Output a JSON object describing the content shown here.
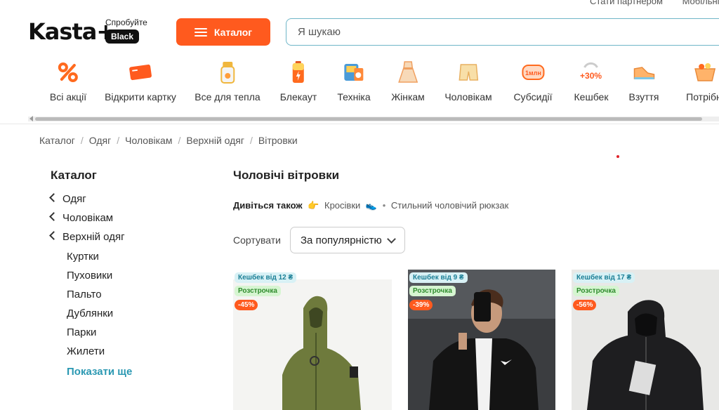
{
  "header": {
    "top_links": [
      "Стати партнером",
      "Мобільні"
    ],
    "logo_text": "Kasta+",
    "promo_try": "Спробуйте",
    "promo_black": "Black",
    "catalog_button": "Каталог",
    "search_placeholder": "Я шукаю"
  },
  "categories": [
    {
      "label": "Всі акції",
      "icon": "percent-icon"
    },
    {
      "label": "Відкрити картку",
      "icon": "card-icon"
    },
    {
      "label": "Все для тепла",
      "icon": "heater-icon"
    },
    {
      "label": "Блекаут",
      "icon": "battery-icon"
    },
    {
      "label": "Техніка",
      "icon": "appliance-icon"
    },
    {
      "label": "Жінкам",
      "icon": "dress-icon"
    },
    {
      "label": "Чоловікам",
      "icon": "shorts-icon"
    },
    {
      "label": "Субсидії",
      "icon": "subsidy-icon"
    },
    {
      "label": "Кешбек",
      "icon": "cashback-icon"
    },
    {
      "label": "Взуття",
      "icon": "shoe-icon"
    },
    {
      "label": "Потрібні",
      "icon": "basket-icon"
    }
  ],
  "cashback_badge_text": "+30%",
  "subsidy_badge_text": "1млн",
  "breadcrumb": [
    "Каталог",
    "Одяг",
    "Чоловікам",
    "Верхній одяг",
    "Вітровки"
  ],
  "sidebar": {
    "title": "Каталог",
    "back_items": [
      "Одяг",
      "Чоловікам",
      "Верхній одяг"
    ],
    "sub_items": [
      "Куртки",
      "Пуховики",
      "Пальто",
      "Дублянки",
      "Парки",
      "Жилети"
    ],
    "show_more": "Показати ще"
  },
  "main": {
    "title": "Чоловічі вітровки",
    "see_also_label": "Дивіться також",
    "see_also_links": [
      "Кросівки",
      "Стильний чоловічий рюкзак"
    ],
    "sort_label": "Сортувати",
    "sort_value": "За популярністю"
  },
  "products": [
    {
      "cashback": "Кешбек від 12 ₴",
      "installment": "Розстрочка",
      "discount": "-45%"
    },
    {
      "cashback": "Кешбек від 9 ₴",
      "installment": "Розстрочка",
      "discount": "-39%"
    },
    {
      "cashback": "Кешбек від 17 ₴",
      "installment": "Розстрочка",
      "discount": "-56%"
    }
  ],
  "colors": {
    "accent": "#ff5a1e",
    "link": "#2a98b2",
    "search_border": "#6fb6c8"
  }
}
